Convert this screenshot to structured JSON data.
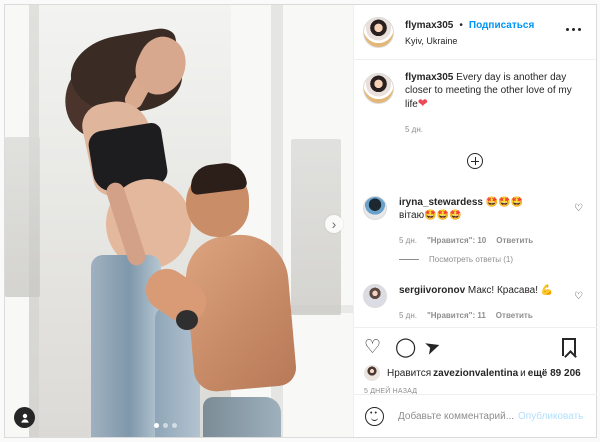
{
  "post": {
    "username": "flymax305",
    "follow_label": "Подписаться",
    "location": "Kyiv, Ukraine",
    "caption": "Every day is another day closer to meeting the other love of my life",
    "caption_time": "5 дн."
  },
  "comments": [
    {
      "username": "iryna_stewardess",
      "text_line1": "🤩🤩🤩",
      "text_line2": "вітаю🤩🤩🤩",
      "time": "5 дн.",
      "likes": "\"Нравится\": 10",
      "reply_label": "Ответить"
    },
    {
      "username": "sergiivoronov",
      "text": "Макс! Красава! 💪",
      "time": "5 дн.",
      "likes": "\"Нравится\": 11",
      "reply_label": "Ответить"
    }
  ],
  "show_replies_label": "Посмотреть ответы (1)",
  "likes": {
    "prefix": "Нравится",
    "user": "zavezionvalentina",
    "middle": "и",
    "count": "ещё 89 206"
  },
  "date_label": "5 ДНЕЙ НАЗАД",
  "composer": {
    "placeholder": "Добавьте комментарий...",
    "publish_label": "Опубликовать"
  },
  "icons": {
    "more": "more-icon",
    "like": "heart-icon",
    "comment": "comment-icon",
    "share": "send-icon",
    "save": "bookmark-icon",
    "emoji": "emoji-icon",
    "next": "chevron-right-icon",
    "tag": "user-tag-icon"
  },
  "colors": {
    "brand_blue": "#0095f6",
    "border": "#dbdbdb",
    "muted_text": "#8e8e8e",
    "heart_red": "#ed4956"
  }
}
